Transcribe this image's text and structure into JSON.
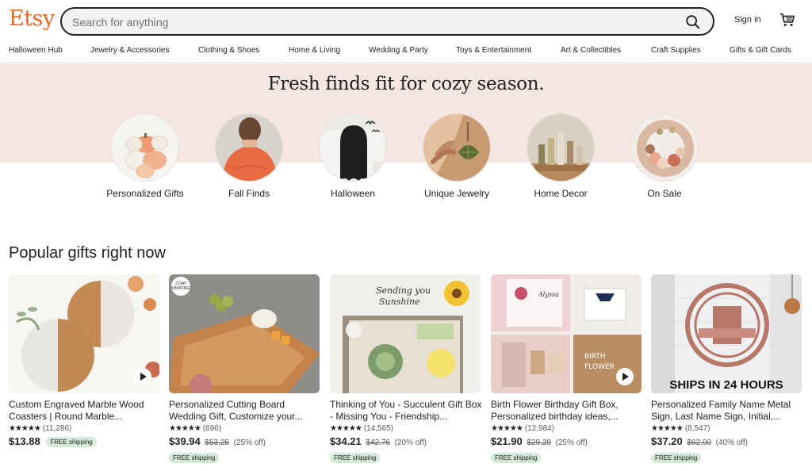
{
  "header": {
    "logo": "Etsy",
    "search_placeholder": "Search for anything",
    "signin": "Sign in"
  },
  "nav": [
    "Halloween Hub",
    "Jewelry & Accessories",
    "Clothing & Shoes",
    "Home & Living",
    "Wedding & Party",
    "Toys & Entertainment",
    "Art & Collectibles",
    "Craft Supplies",
    "Gifts & Gift Cards"
  ],
  "hero": {
    "title": "Fresh finds fit for cozy season.",
    "categories": [
      "Personalized Gifts",
      "Fall Finds",
      "Halloween",
      "Unique Jewelry",
      "Home Decor",
      "On Sale"
    ]
  },
  "popular": {
    "title": "Popular gifts right now",
    "items": [
      {
        "title": "Custom Engraved Marble Wood Coasters | Round Marble...",
        "stars": "★★★★★",
        "reviews": "(11,286)",
        "price": "$13.88",
        "old_price": "",
        "discount": "",
        "shipping": "FREE shipping"
      },
      {
        "title": "Personalized Cutting Board Wedding Gift, Customize your...",
        "stars": "★★★★★",
        "reviews": "(696)",
        "price": "$39.94",
        "old_price": "$53.25",
        "discount": "(25% off)",
        "shipping": "FREE shipping",
        "badge": "2 DAY SHIPPING!"
      },
      {
        "title": "Thinking of You - Succulent Gift Box - Missing You - Friendship...",
        "stars": "★★★★★",
        "reviews": "(14,565)",
        "price": "$34.21",
        "old_price": "$42.76",
        "discount": "(20% off)",
        "shipping": "FREE shipping",
        "img_text": "Sending you Sunshine"
      },
      {
        "title": "Birth Flower Birthday Gift Box, Personalized birthday ideas,...",
        "stars": "★★★★★",
        "reviews": "(12,984)",
        "price": "$21.90",
        "old_price": "$29.20",
        "discount": "(25% off)",
        "shipping": "FREE shipping",
        "img_text": "BIRTH FLOWER"
      },
      {
        "title": "Personalized Family Name Metal Sign, Last Name Sign, Initial,...",
        "stars": "★★★★★",
        "reviews": "(8,547)",
        "price": "$37.20",
        "old_price": "$62.00",
        "discount": "(40% off)",
        "shipping": "FREE shipping",
        "img_text": "SHIPS IN 24 HOURS"
      }
    ]
  },
  "colors": {
    "brand": "#f1641e",
    "hero_bg": "#f4e7e2",
    "shipping_badge": "#d4e9d7"
  }
}
